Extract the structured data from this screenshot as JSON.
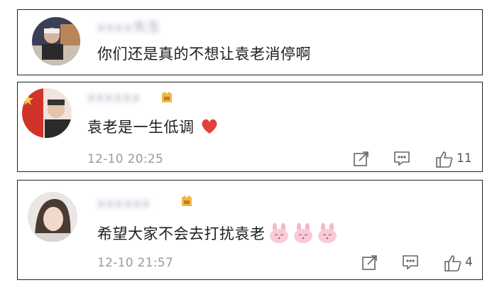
{
  "comments": [
    {
      "username": "xxxx先生",
      "text": "你们还是真的不想让袁老消停啊"
    },
    {
      "username": "xxxxxx",
      "text": "袁老是一生低调",
      "time": "12-10 20:25",
      "likes": "11"
    },
    {
      "username": "xxxxxx",
      "text": "希望大家不会去打扰袁老",
      "time": "12-10 21:57",
      "likes": "4"
    }
  ],
  "icons": {
    "share": "share-icon",
    "comment": "comment-icon",
    "like": "thumbs-up-icon",
    "heart": "heart-emoji",
    "bunny": "bunny-emoji"
  },
  "colors": {
    "heart": "#e0413a",
    "bunny": "#f3b8c6",
    "time": "#9a9a9a",
    "username_blur": "#9aa3b5"
  }
}
